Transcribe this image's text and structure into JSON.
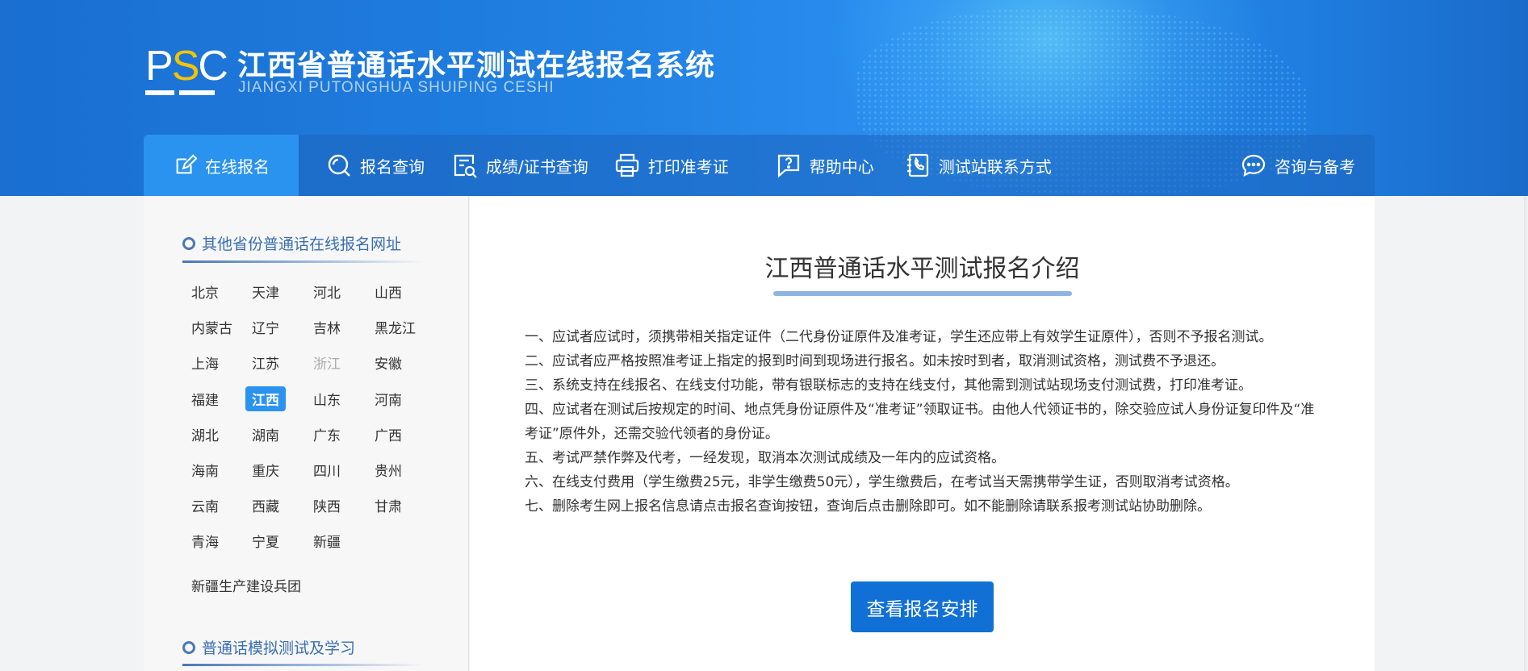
{
  "header": {
    "logo_text_p": "P",
    "logo_text_s": "S",
    "logo_text_c": "C",
    "title": "江西省普通话水平测试在线报名系统",
    "subtitle": "JIANGXI PUTONGHUA SHUIPING CESHI"
  },
  "nav": {
    "items": [
      {
        "label": "在线报名",
        "icon": "edit-icon",
        "active": true
      },
      {
        "label": "报名查询",
        "icon": "search-icon"
      },
      {
        "label": "成绩/证书查询",
        "icon": "certificate-search-icon"
      },
      {
        "label": "打印准考证",
        "icon": "printer-icon"
      },
      {
        "label": "帮助中心",
        "icon": "help-icon"
      },
      {
        "label": "测试站联系方式",
        "icon": "phone-book-icon"
      }
    ],
    "right": {
      "label": "咨询与备考",
      "icon": "chat-icon"
    }
  },
  "sidebar": {
    "section1_title": "其他省份普通话在线报名网址",
    "provinces": [
      [
        "北京",
        "天津",
        "河北",
        "山西"
      ],
      [
        "内蒙古",
        "辽宁",
        "吉林",
        "黑龙江"
      ],
      [
        "上海",
        "江苏",
        "浙江",
        "安徽"
      ],
      [
        "福建",
        "江西",
        "山东",
        "河南"
      ],
      [
        "湖北",
        "湖南",
        "广东",
        "广西"
      ],
      [
        "海南",
        "重庆",
        "四川",
        "贵州"
      ],
      [
        "云南",
        "西藏",
        "陕西",
        "甘肃"
      ],
      [
        "青海",
        "宁夏",
        "新疆"
      ]
    ],
    "selected_province": "江西",
    "disabled_province": "浙江",
    "extra": "新疆生产建设兵团",
    "section2_title": "普通话模拟测试及学习"
  },
  "main": {
    "title": "江西普通话水平测试报名介绍",
    "rules": [
      "一、应试者应试时，须携带相关指定证件（二代身份证原件及准考证，学生还应带上有效学生证原件），否则不予报名测试。",
      "二、应试者应严格按照准考证上指定的报到时间到现场进行报名。如未按时到者，取消测试资格，测试费不予退还。",
      "三、系统支持在线报名、在线支付功能，带有银联标志的支持在线支付，其他需到测试站现场支付测试费，打印准考证。",
      "四、应试者在测试后按规定的时间、地点凭身份证原件及“准考证”领取证书。由他人代领证书的，除交验应试人身份证复印件及“准考证”原件外，还需交验代领者的身份证。",
      "五、考试严禁作弊及代考，一经发现，取消本次测试成绩及一年内的应试资格。",
      "六、在线支付费用（学生缴费25元，非学生缴费50元），学生缴费后，在考试当天需携带学生证，否则取消考试资格。",
      "七、删除考生网上报名信息请点击报名查询按钮，查询后点击删除即可。如不能删除请联系报考测试站协助删除。"
    ],
    "cta_label": "查看报名安排"
  },
  "colors": {
    "header_blue": "#1f7ee0",
    "nav_active": "#2a93f0",
    "cta_blue": "#1170d6",
    "logo_accent": "#f5c400"
  }
}
